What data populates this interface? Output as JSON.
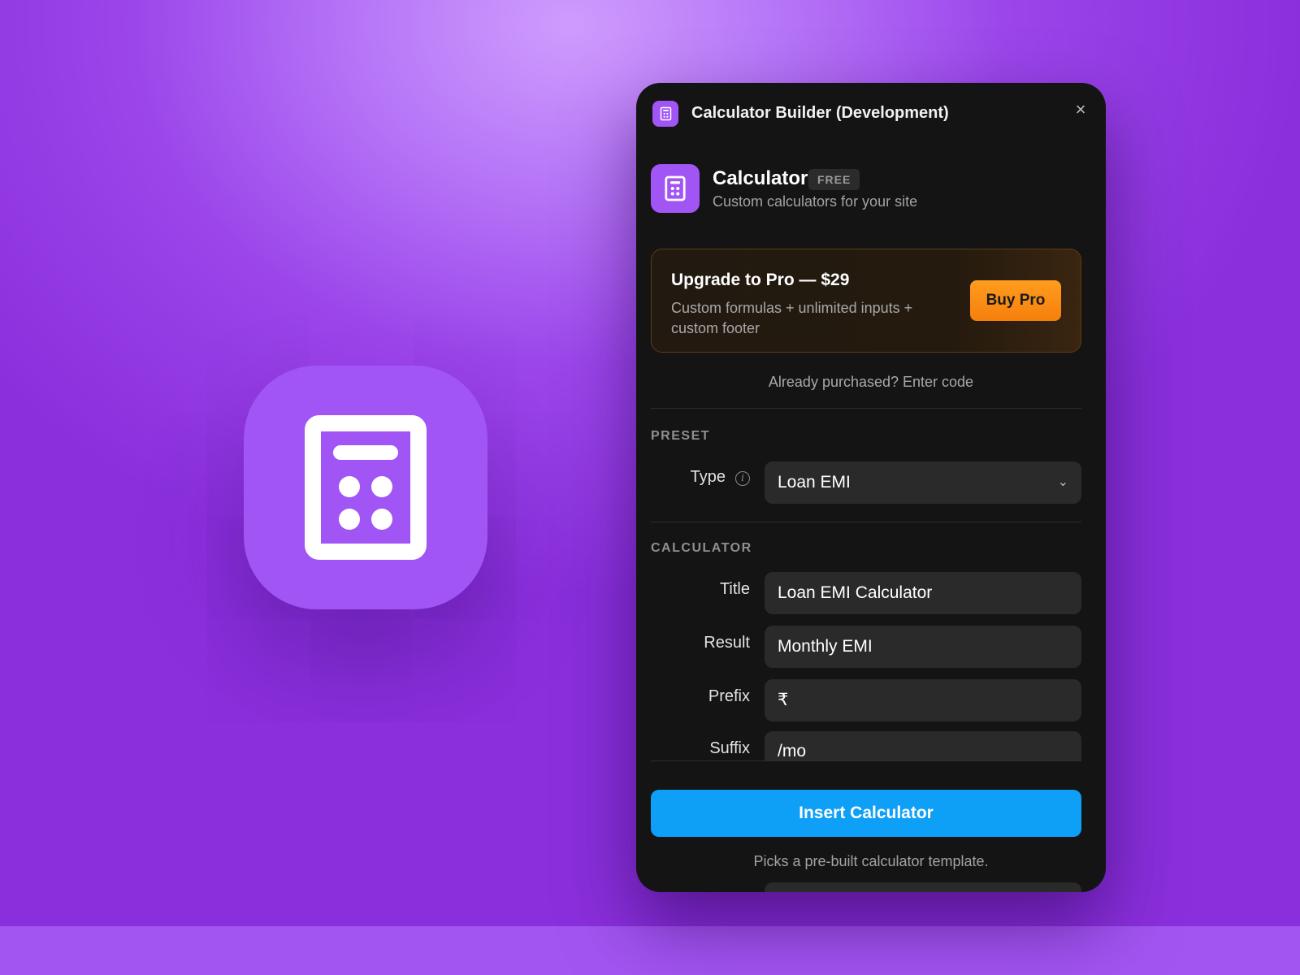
{
  "window": {
    "title": "Calculator Builder (Development)",
    "close_label": "×"
  },
  "plugin": {
    "name": "Calculator",
    "badge": "FREE",
    "subtitle": "Custom calculators for your site"
  },
  "upgrade": {
    "title": "Upgrade to Pro — $29",
    "description": "Custom formulas + unlimited inputs + custom footer",
    "button": "Buy Pro",
    "accent": "#f57f0c"
  },
  "purchased_link": "Already purchased? Enter code",
  "preset": {
    "section": "PRESET",
    "type_label": "Type",
    "type_value": "Loan EMI"
  },
  "calculator": {
    "section": "CALCULATOR",
    "fields": [
      {
        "label": "Title",
        "value": "Loan EMI Calculator"
      },
      {
        "label": "Result",
        "value": "Monthly EMI"
      },
      {
        "label": "Prefix",
        "value": "₹"
      },
      {
        "label": "Suffix",
        "value": "/mo"
      }
    ]
  },
  "insert_button": "Insert Calculator",
  "hint": "Picks a pre-built calculator template.",
  "colors": {
    "brand_purple": "#a155f4",
    "primary_blue": "#0e9ff6"
  },
  "icons": [
    "calculator-icon",
    "close-icon",
    "info-icon",
    "chevron-down-icon"
  ]
}
